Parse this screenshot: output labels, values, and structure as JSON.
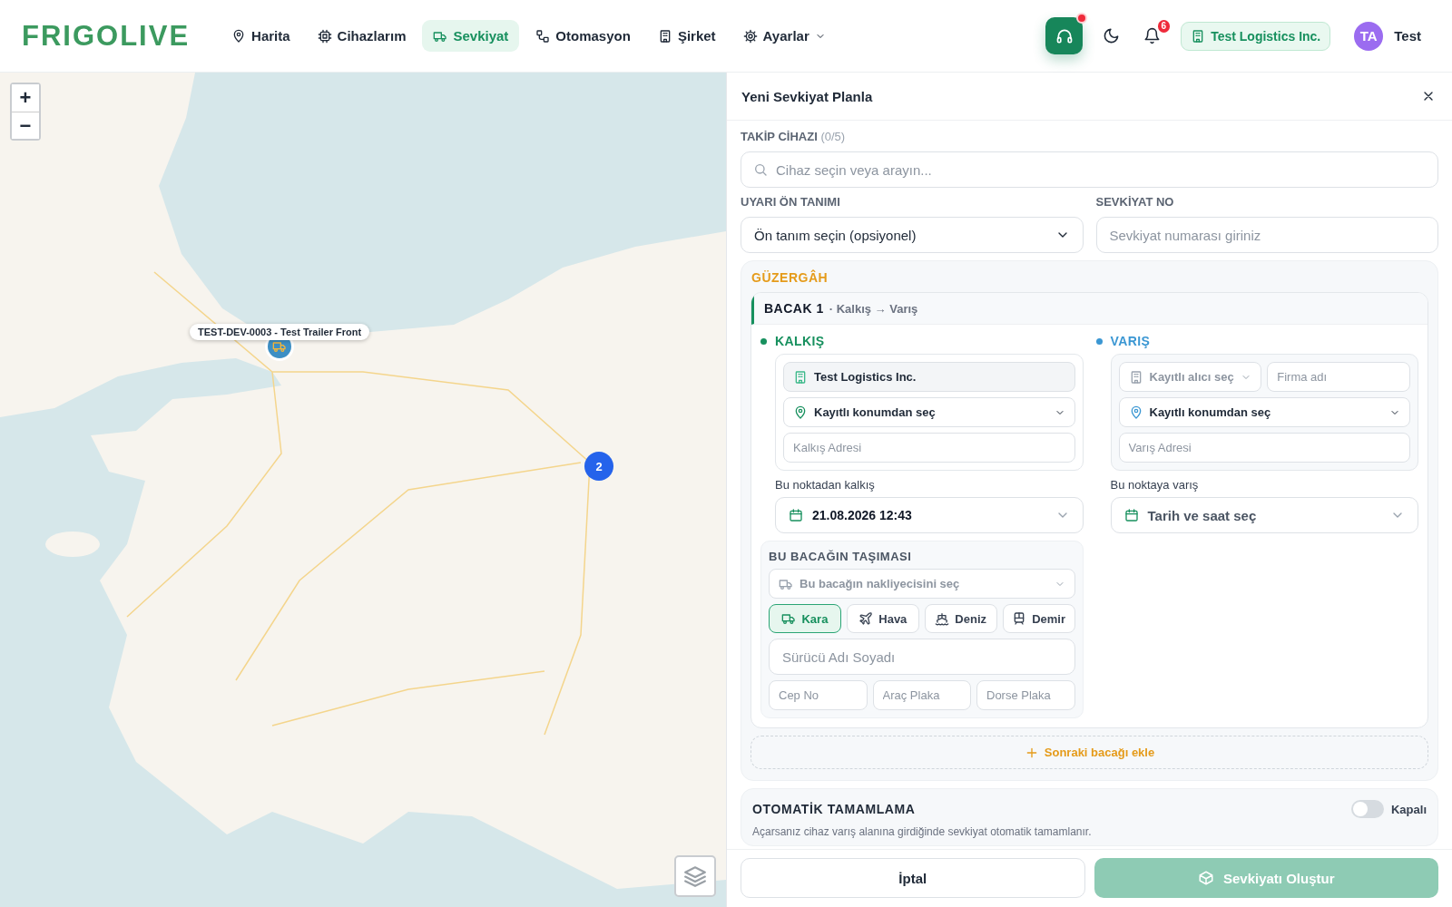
{
  "header": {
    "logo": "FRIGOLIVE",
    "nav": [
      {
        "label": "Harita",
        "selected": false,
        "kind": "link"
      },
      {
        "label": "Cihazlarım",
        "selected": false,
        "kind": "link"
      },
      {
        "label": "Sevkiyat",
        "selected": true,
        "kind": "link"
      },
      {
        "label": "Otomasyon",
        "selected": false,
        "kind": "link"
      },
      {
        "label": "Şirket",
        "selected": false,
        "kind": "link"
      },
      {
        "label": "Ayarlar",
        "selected": false,
        "kind": "dropdown"
      }
    ],
    "notification_count": "6",
    "company": "Test Logistics Inc.",
    "user": {
      "initials": "TA",
      "name": "Test"
    }
  },
  "map": {
    "zoom_in": "+",
    "zoom_out": "−",
    "markers": [
      {
        "kind": "device",
        "tooltip": "TEST-DEV-0003 - Test Trailer Front"
      },
      {
        "kind": "cluster",
        "count": "2"
      }
    ]
  },
  "panel": {
    "title": "Yeni Sevkiyat Planla",
    "device": {
      "label": "TAKİP CİHAZI",
      "count": "(0/5)",
      "placeholder": "Cihaz seçin veya arayın..."
    },
    "alert_preset": {
      "label": "UYARI ÖN TANIMI",
      "value": "Ön tanım seçin (opsiyonel)"
    },
    "shipment_no": {
      "label": "SEVKİYAT NO",
      "placeholder": "Sevkiyat numarası giriniz"
    },
    "route": {
      "title": "GÜZERGÂH",
      "legs": [
        {
          "title": "BACAK 1",
          "subtitle": "· Kalkış → Varış",
          "departure": {
            "title": "KALKIŞ",
            "company": "Test Logistics Inc.",
            "location_select": "Kayıtlı konumdan seç",
            "address_placeholder": "Kalkış Adresi",
            "time_label": "Bu noktadan kalkış",
            "time_value": "21.08.2026 12:43"
          },
          "arrival": {
            "title": "VARIŞ",
            "recipient_select": "Kayıtlı alıcı seç",
            "company_placeholder": "Firma adı",
            "location_select": "Kayıtlı konumdan seç",
            "address_placeholder": "Varış Adresi",
            "time_label": "Bu noktaya varış",
            "time_placeholder": "Tarih ve saat seç"
          },
          "transport": {
            "title": "BU BACAĞIN TAŞIMASI",
            "carrier_select": "Bu bacağın nakliyecisini seç",
            "modes": [
              {
                "label": "Kara",
                "selected": true
              },
              {
                "label": "Hava",
                "selected": false
              },
              {
                "label": "Deniz",
                "selected": false
              },
              {
                "label": "Demir",
                "selected": false
              }
            ],
            "driver_placeholder": "Sürücü Adı Soyadı",
            "phone_placeholder": "Cep No",
            "plate_placeholder": "Araç Plaka",
            "trailer_placeholder": "Dorse Plaka"
          }
        }
      ],
      "add_leg": "Sonraki bacağı ekle"
    },
    "auto_complete": {
      "title": "OTOMATİK TAMAMLAMA",
      "on": false,
      "state_label": "Kapalı",
      "description": "Açarsanız cihaz varış alanına girdiğinde sevkiyat otomatik tamamlanır."
    },
    "cancel": "İptal",
    "submit": {
      "label": "Sevkiyatı Oluştur",
      "disabled": true
    }
  }
}
